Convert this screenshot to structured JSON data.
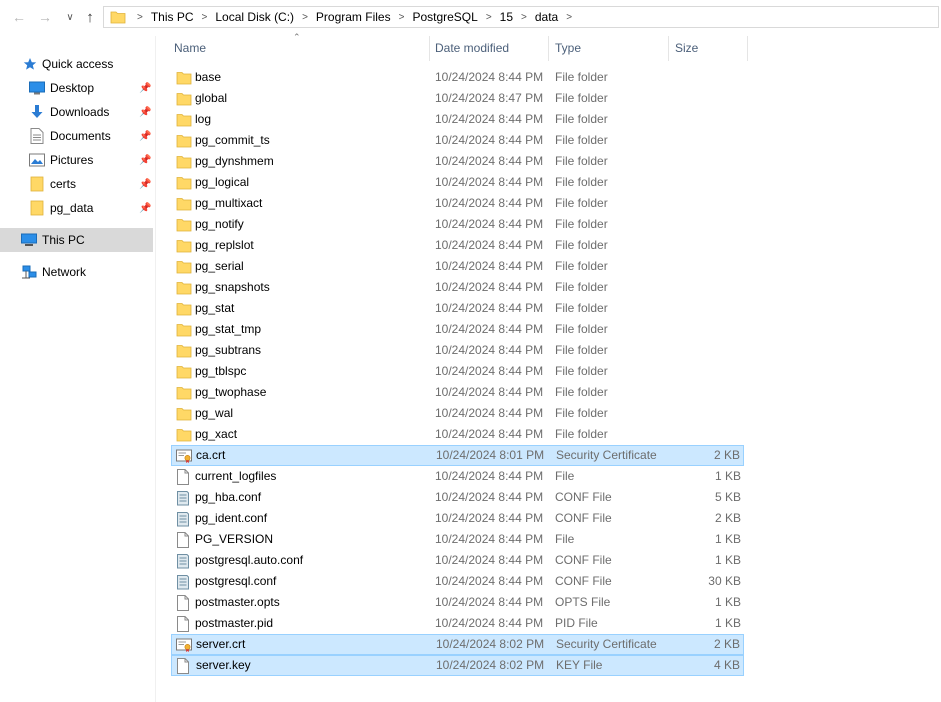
{
  "address": {
    "crumbs": [
      "This PC",
      "Local Disk (C:)",
      "Program Files",
      "PostgreSQL",
      "15",
      "data"
    ]
  },
  "nav": {
    "quick_access": "Quick access",
    "pinned": [
      {
        "label": "Desktop",
        "icon": "desktop-icon"
      },
      {
        "label": "Downloads",
        "icon": "downloads-icon"
      },
      {
        "label": "Documents",
        "icon": "documents-icon"
      },
      {
        "label": "Pictures",
        "icon": "pictures-icon"
      },
      {
        "label": "certs",
        "icon": "folder-icon"
      },
      {
        "label": "pg_data",
        "icon": "folder-icon"
      }
    ],
    "this_pc": "This PC",
    "network": "Network"
  },
  "columns": {
    "name": "Name",
    "date": "Date modified",
    "type": "Type",
    "size": "Size"
  },
  "files": [
    {
      "name": "base",
      "date": "10/24/2024 8:44 PM",
      "type": "File folder",
      "size": "",
      "icon": "folder-icon"
    },
    {
      "name": "global",
      "date": "10/24/2024 8:47 PM",
      "type": "File folder",
      "size": "",
      "icon": "folder-icon"
    },
    {
      "name": "log",
      "date": "10/24/2024 8:44 PM",
      "type": "File folder",
      "size": "",
      "icon": "folder-icon"
    },
    {
      "name": "pg_commit_ts",
      "date": "10/24/2024 8:44 PM",
      "type": "File folder",
      "size": "",
      "icon": "folder-icon"
    },
    {
      "name": "pg_dynshmem",
      "date": "10/24/2024 8:44 PM",
      "type": "File folder",
      "size": "",
      "icon": "folder-icon"
    },
    {
      "name": "pg_logical",
      "date": "10/24/2024 8:44 PM",
      "type": "File folder",
      "size": "",
      "icon": "folder-icon"
    },
    {
      "name": "pg_multixact",
      "date": "10/24/2024 8:44 PM",
      "type": "File folder",
      "size": "",
      "icon": "folder-icon"
    },
    {
      "name": "pg_notify",
      "date": "10/24/2024 8:44 PM",
      "type": "File folder",
      "size": "",
      "icon": "folder-icon"
    },
    {
      "name": "pg_replslot",
      "date": "10/24/2024 8:44 PM",
      "type": "File folder",
      "size": "",
      "icon": "folder-icon"
    },
    {
      "name": "pg_serial",
      "date": "10/24/2024 8:44 PM",
      "type": "File folder",
      "size": "",
      "icon": "folder-icon"
    },
    {
      "name": "pg_snapshots",
      "date": "10/24/2024 8:44 PM",
      "type": "File folder",
      "size": "",
      "icon": "folder-icon"
    },
    {
      "name": "pg_stat",
      "date": "10/24/2024 8:44 PM",
      "type": "File folder",
      "size": "",
      "icon": "folder-icon"
    },
    {
      "name": "pg_stat_tmp",
      "date": "10/24/2024 8:44 PM",
      "type": "File folder",
      "size": "",
      "icon": "folder-icon"
    },
    {
      "name": "pg_subtrans",
      "date": "10/24/2024 8:44 PM",
      "type": "File folder",
      "size": "",
      "icon": "folder-icon"
    },
    {
      "name": "pg_tblspc",
      "date": "10/24/2024 8:44 PM",
      "type": "File folder",
      "size": "",
      "icon": "folder-icon"
    },
    {
      "name": "pg_twophase",
      "date": "10/24/2024 8:44 PM",
      "type": "File folder",
      "size": "",
      "icon": "folder-icon"
    },
    {
      "name": "pg_wal",
      "date": "10/24/2024 8:44 PM",
      "type": "File folder",
      "size": "",
      "icon": "folder-icon"
    },
    {
      "name": "pg_xact",
      "date": "10/24/2024 8:44 PM",
      "type": "File folder",
      "size": "",
      "icon": "folder-icon"
    },
    {
      "name": "ca.crt",
      "date": "10/24/2024 8:01 PM",
      "type": "Security Certificate",
      "size": "2 KB",
      "icon": "certificate-icon",
      "selected": true
    },
    {
      "name": "current_logfiles",
      "date": "10/24/2024 8:44 PM",
      "type": "File",
      "size": "1 KB",
      "icon": "file-icon"
    },
    {
      "name": "pg_hba.conf",
      "date": "10/24/2024 8:44 PM",
      "type": "CONF File",
      "size": "5 KB",
      "icon": "conf-file-icon"
    },
    {
      "name": "pg_ident.conf",
      "date": "10/24/2024 8:44 PM",
      "type": "CONF File",
      "size": "2 KB",
      "icon": "conf-file-icon"
    },
    {
      "name": "PG_VERSION",
      "date": "10/24/2024 8:44 PM",
      "type": "File",
      "size": "1 KB",
      "icon": "file-icon"
    },
    {
      "name": "postgresql.auto.conf",
      "date": "10/24/2024 8:44 PM",
      "type": "CONF File",
      "size": "1 KB",
      "icon": "conf-file-icon"
    },
    {
      "name": "postgresql.conf",
      "date": "10/24/2024 8:44 PM",
      "type": "CONF File",
      "size": "30 KB",
      "icon": "conf-file-icon"
    },
    {
      "name": "postmaster.opts",
      "date": "10/24/2024 8:44 PM",
      "type": "OPTS File",
      "size": "1 KB",
      "icon": "file-icon"
    },
    {
      "name": "postmaster.pid",
      "date": "10/24/2024 8:44 PM",
      "type": "PID File",
      "size": "1 KB",
      "icon": "file-icon"
    },
    {
      "name": "server.crt",
      "date": "10/24/2024 8:02 PM",
      "type": "Security Certificate",
      "size": "2 KB",
      "icon": "certificate-icon",
      "selected": true
    },
    {
      "name": "server.key",
      "date": "10/24/2024 8:02 PM",
      "type": "KEY File",
      "size": "4 KB",
      "icon": "file-icon",
      "selected": true
    }
  ],
  "colors": {
    "selection_bg": "#cce8ff",
    "selection_border": "#99d1ff",
    "folder": "#ffd866",
    "header_text": "#4c607a"
  }
}
